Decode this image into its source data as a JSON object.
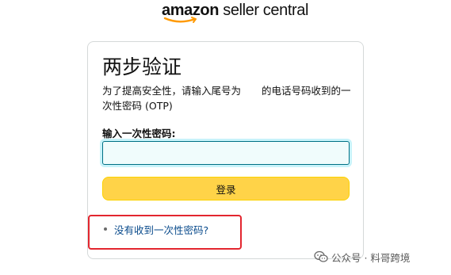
{
  "logo": {
    "brand": "amazon",
    "product": " seller central"
  },
  "card": {
    "title": "两步验证",
    "desc_before": "为了提高安全性，请输入尾号为",
    "desc_after": "的电话号码收到的一次性密码 (OTP)"
  },
  "otp": {
    "label": "输入一次性密码:",
    "value": ""
  },
  "login": {
    "label": "登录"
  },
  "help": {
    "link_label": "没有收到一次性密码?"
  },
  "watermark": {
    "text": "公众号 · 料哥跨境",
    "icon": "wechat-icon"
  },
  "colors": {
    "button": "#ffd348",
    "input_focus": "#007185",
    "link": "#0a4b8c",
    "highlight": "#e3262f"
  }
}
